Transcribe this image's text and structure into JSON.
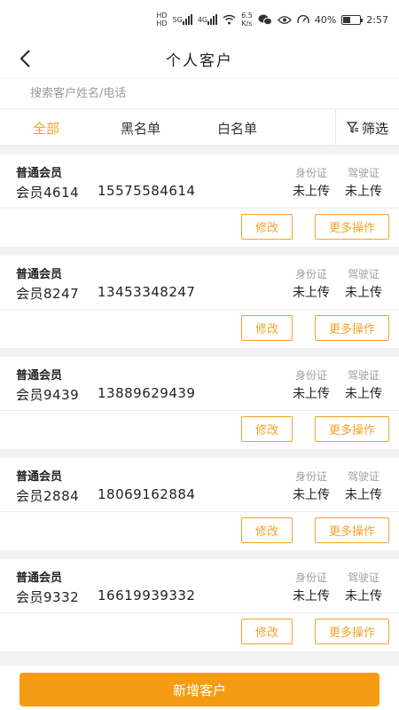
{
  "status_bar": {
    "hd1": "HD",
    "hd2": "HD",
    "net_a": "5G",
    "net_b": "4G",
    "speed_value": "6.5",
    "speed_unit": "K/s",
    "battery": "40%",
    "time": "2:57"
  },
  "nav": {
    "title": "个人客户"
  },
  "search": {
    "placeholder": "搜索客户姓名/电话"
  },
  "tabs": [
    {
      "label": "全部",
      "active": true
    },
    {
      "label": "黑名单",
      "active": false
    },
    {
      "label": "白名单",
      "active": false
    }
  ],
  "filter": {
    "label": "筛选"
  },
  "customers": [
    {
      "level": "普通会员",
      "name": "会员4614",
      "phone": "15575584614",
      "id_label": "身份证",
      "id_status": "未上传",
      "license_label": "驾驶证",
      "license_status": "未上传",
      "edit_label": "修改",
      "more_label": "更多操作"
    },
    {
      "level": "普通会员",
      "name": "会员8247",
      "phone": "13453348247",
      "id_label": "身份证",
      "id_status": "未上传",
      "license_label": "驾驶证",
      "license_status": "未上传",
      "edit_label": "修改",
      "more_label": "更多操作"
    },
    {
      "level": "普通会员",
      "name": "会员9439",
      "phone": "13889629439",
      "id_label": "身份证",
      "id_status": "未上传",
      "license_label": "驾驶证",
      "license_status": "未上传",
      "edit_label": "修改",
      "more_label": "更多操作"
    },
    {
      "level": "普通会员",
      "name": "会员2884",
      "phone": "18069162884",
      "id_label": "身份证",
      "id_status": "未上传",
      "license_label": "驾驶证",
      "license_status": "未上传",
      "edit_label": "修改",
      "more_label": "更多操作"
    },
    {
      "level": "普通会员",
      "name": "会员9332",
      "phone": "16619939332",
      "id_label": "身份证",
      "id_status": "未上传",
      "license_label": "驾驶证",
      "license_status": "未上传",
      "edit_label": "修改",
      "more_label": "更多操作"
    }
  ],
  "footer": {
    "add_label": "新增客户"
  },
  "colors": {
    "accent": "#f2a228",
    "primary_button": "#f59c14",
    "background": "#f2f2f2"
  }
}
